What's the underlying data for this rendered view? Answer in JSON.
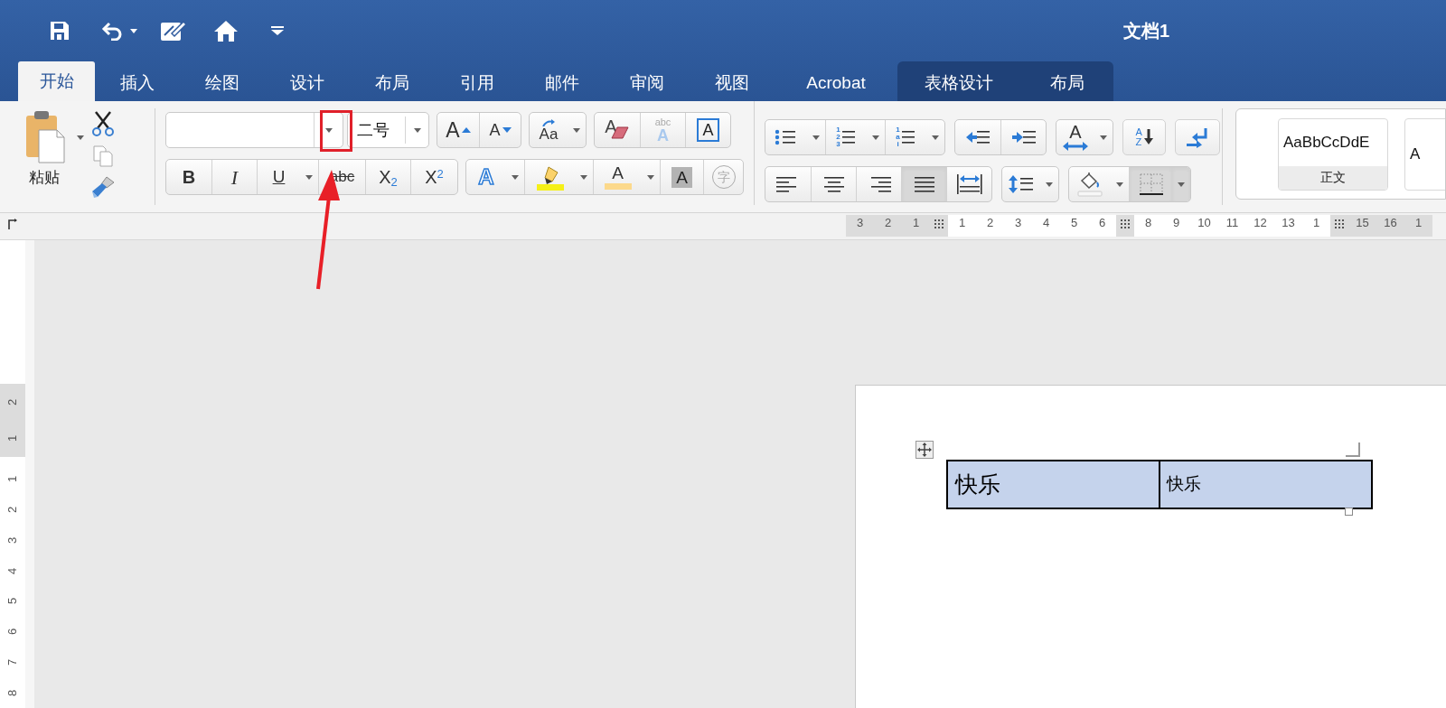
{
  "window": {
    "title": "文档1"
  },
  "tabs": [
    {
      "label": "开始",
      "selected": true,
      "contextual": false
    },
    {
      "label": "插入",
      "selected": false,
      "contextual": false
    },
    {
      "label": "绘图",
      "selected": false,
      "contextual": false
    },
    {
      "label": "设计",
      "selected": false,
      "contextual": false
    },
    {
      "label": "布局",
      "selected": false,
      "contextual": false
    },
    {
      "label": "引用",
      "selected": false,
      "contextual": false
    },
    {
      "label": "邮件",
      "selected": false,
      "contextual": false
    },
    {
      "label": "审阅",
      "selected": false,
      "contextual": false
    },
    {
      "label": "视图",
      "selected": false,
      "contextual": false
    },
    {
      "label": "Acrobat",
      "selected": false,
      "contextual": false
    },
    {
      "label": "表格设计",
      "selected": false,
      "contextual": true
    },
    {
      "label": "布局",
      "selected": false,
      "contextual": true
    }
  ],
  "clipboard": {
    "paste_label": "粘贴"
  },
  "font_size": {
    "value": "二号"
  },
  "font_rows": [
    [
      [
        {
          "kind": "grow",
          "glyph": "A"
        },
        {
          "kind": "shrink",
          "glyph": "A"
        }
      ],
      [
        {
          "kind": "change_case",
          "glyph": "Aa",
          "dropdown": true
        }
      ],
      [
        {
          "kind": "clear_format",
          "glyph": "A"
        },
        {
          "kind": "phonetic",
          "glyph": "abc",
          "glyph2": "A"
        },
        {
          "kind": "char_border",
          "glyph": "A"
        }
      ]
    ],
    [
      [
        {
          "kind": "bold",
          "glyph": "B"
        },
        {
          "kind": "italic",
          "glyph": "I"
        },
        {
          "kind": "underline",
          "glyph": "U",
          "dropdown": true
        },
        {
          "kind": "strike",
          "glyph": "abc"
        },
        {
          "kind": "subscript",
          "glyph": "X$_{2}$"
        },
        {
          "kind": "superscript",
          "glyph": "X$^{2}$"
        }
      ],
      [
        {
          "kind": "text_effect",
          "glyph": "A",
          "dropdown": true
        },
        {
          "kind": "highlight",
          "dropdown": true
        },
        {
          "kind": "font_color",
          "glyph": "A",
          "dropdown": true
        },
        {
          "kind": "char_shading",
          "glyph": "A"
        },
        {
          "kind": "enclose",
          "glyph": "字"
        }
      ]
    ]
  ],
  "paragraph_rows": [
    [
      [
        {
          "kind": "bullets",
          "dropdown": true
        },
        {
          "kind": "numbering",
          "glyph": "123",
          "dropdown": true
        },
        {
          "kind": "multilevel",
          "glyph": "1ai",
          "dropdown": true
        }
      ],
      [
        {
          "kind": "decrease_indent"
        },
        {
          "kind": "increase_indent"
        }
      ],
      [
        {
          "kind": "text_direction",
          "glyph": "A",
          "dropdown": true
        }
      ],
      [
        {
          "kind": "sort",
          "glyph": "AZ"
        }
      ],
      [
        {
          "kind": "show_marks"
        }
      ]
    ],
    [
      [
        {
          "kind": "align_left",
          "selected": false
        },
        {
          "kind": "align_center",
          "selected": false
        },
        {
          "kind": "align_right",
          "selected": false
        },
        {
          "kind": "justify",
          "selected": true
        },
        {
          "kind": "distribute",
          "selected": false
        }
      ],
      [
        {
          "kind": "line_spacing",
          "dropdown": true
        }
      ],
      [
        {
          "kind": "shading",
          "dropdown": true,
          "selected": false
        },
        {
          "kind": "borders",
          "dropdown": true,
          "selected": true
        }
      ]
    ]
  ],
  "styles": [
    {
      "preview": "AaBbCcDdE",
      "name": "正文"
    },
    {
      "preview": "A"
    }
  ],
  "horizontal_ruler": [
    {
      "kind": "numbers",
      "shaded": true,
      "labels": [
        "3",
        "2",
        "1"
      ]
    },
    {
      "kind": "marker"
    },
    {
      "kind": "numbers",
      "shaded": false,
      "labels": [
        "1",
        "2",
        "3",
        "4",
        "5",
        "6"
      ]
    },
    {
      "kind": "marker"
    },
    {
      "kind": "numbers",
      "shaded": false,
      "labels": [
        "8",
        "9",
        "10",
        "11",
        "12",
        "13",
        "1"
      ]
    },
    {
      "kind": "marker"
    },
    {
      "kind": "numbers",
      "shaded": true,
      "labels": [
        "15",
        "16",
        "1"
      ]
    }
  ],
  "vertical_ruler": [
    {
      "shaded": true,
      "labels": [
        "2",
        "1"
      ]
    },
    {
      "shaded": false,
      "labels": [
        "1",
        "2",
        "3",
        "4",
        "5",
        "6",
        "7",
        "8"
      ]
    }
  ],
  "table": {
    "rows": [
      [
        {
          "text": "快乐",
          "selected": true
        },
        {
          "text": "快乐",
          "selected": true
        }
      ]
    ]
  }
}
